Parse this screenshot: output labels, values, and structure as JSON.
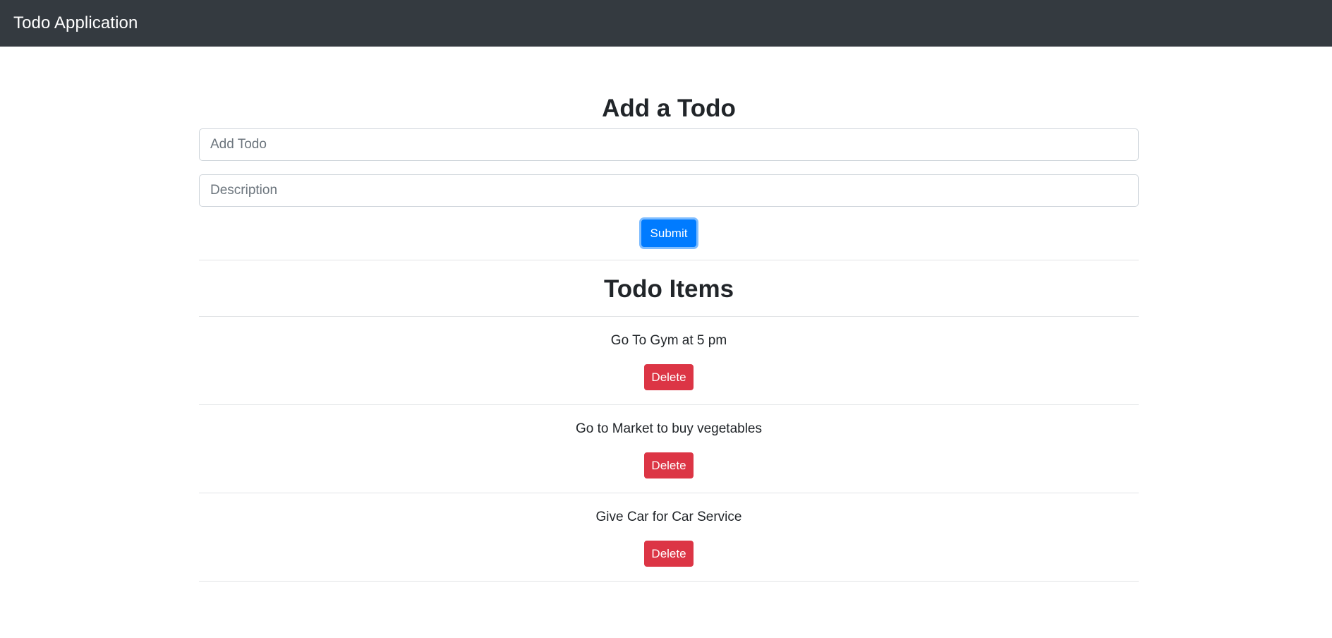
{
  "navbar": {
    "brand": "Todo Application"
  },
  "form": {
    "title": "Add a Todo",
    "todo_placeholder": "Add Todo",
    "description_placeholder": "Description",
    "submit_label": "Submit"
  },
  "todos": {
    "title": "Todo Items",
    "items": [
      {
        "text": "Go To Gym at 5 pm",
        "delete_label": "Delete"
      },
      {
        "text": "Go to Market to buy vegetables",
        "delete_label": "Delete"
      },
      {
        "text": "Give Car for Car Service",
        "delete_label": "Delete"
      }
    ]
  },
  "colors": {
    "navbar_bg": "#343a40",
    "primary": "#007bff",
    "danger": "#dc3545"
  }
}
